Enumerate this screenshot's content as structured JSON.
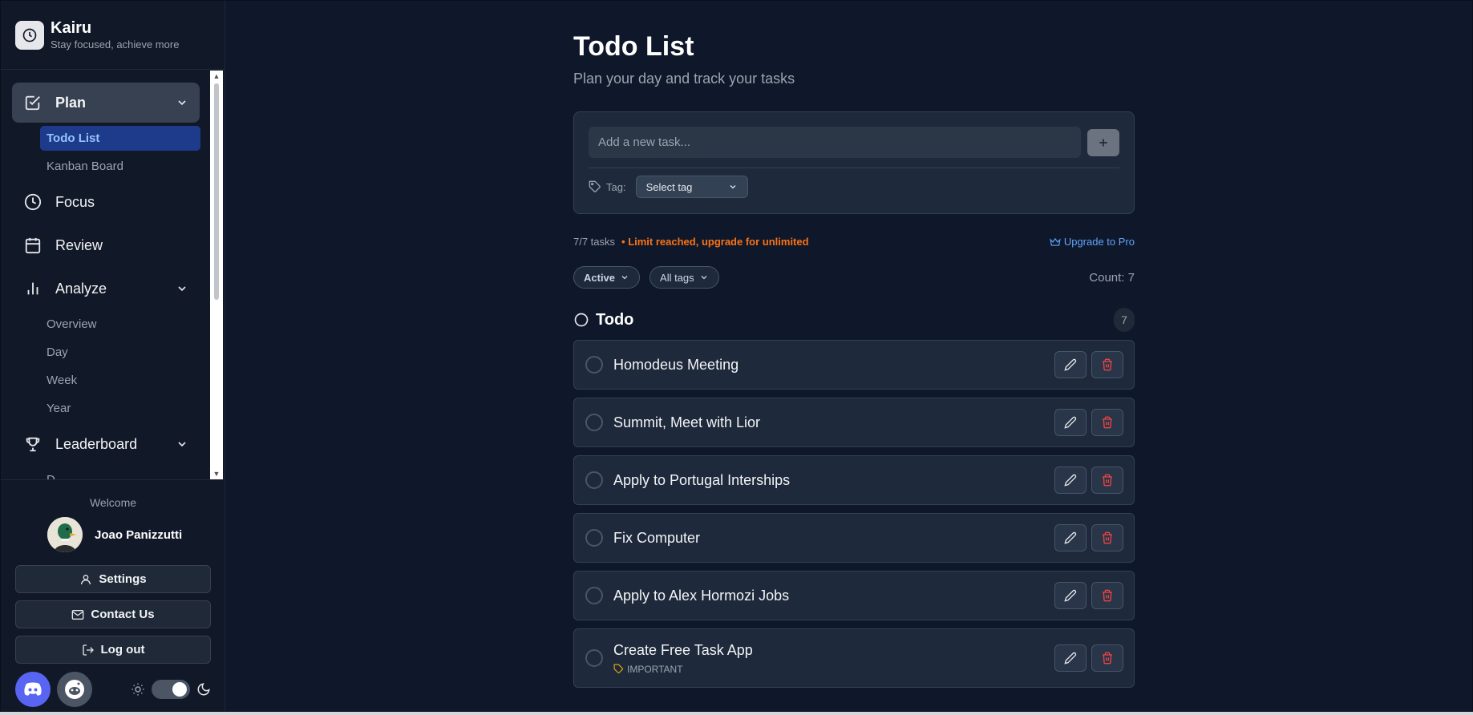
{
  "brand": {
    "name": "Kairu",
    "tagline": "Stay focused, achieve more"
  },
  "sidebar": {
    "groups": [
      {
        "label": "Plan",
        "subitems": [
          "Todo List",
          "Kanban Board"
        ]
      },
      {
        "label": "Focus"
      },
      {
        "label": "Review"
      },
      {
        "label": "Analyze",
        "subitems": [
          "Overview",
          "Day",
          "Week",
          "Year"
        ]
      },
      {
        "label": "Leaderboard",
        "subitems": [
          "D..."
        ]
      }
    ],
    "active_item": "Todo List"
  },
  "footer": {
    "welcome": "Welcome",
    "user_name": "Joao Panizzutti",
    "settings": "Settings",
    "contact": "Contact Us",
    "logout": "Log out"
  },
  "page": {
    "title": "Todo List",
    "subtitle": "Plan your day and track your tasks"
  },
  "add_task": {
    "placeholder": "Add a new task...",
    "tag_label": "Tag:",
    "tag_select": "Select tag"
  },
  "meta": {
    "task_count": "7/7 tasks",
    "limit": "• Limit reached, upgrade for unlimited",
    "upgrade": "Upgrade to Pro"
  },
  "filters": {
    "status": "Active",
    "tags": "All tags",
    "count": "Count: 7"
  },
  "section": {
    "title": "Todo",
    "count": "7"
  },
  "tasks": [
    {
      "title": "Homodeus Meeting"
    },
    {
      "title": "Summit, Meet with Lior"
    },
    {
      "title": "Apply to Portugal Interships"
    },
    {
      "title": "Fix Computer"
    },
    {
      "title": "Apply to Alex Hormozi Jobs"
    },
    {
      "title": "Create Free Task App",
      "tag": "IMPORTANT"
    }
  ],
  "colors": {
    "background": "#0f172a",
    "sidebar": "#111827",
    "card": "#1e293b",
    "accent": "#60a5fa",
    "warning": "#f97316",
    "danger": "#ef4444",
    "active_nav": "#1e3a8a"
  }
}
